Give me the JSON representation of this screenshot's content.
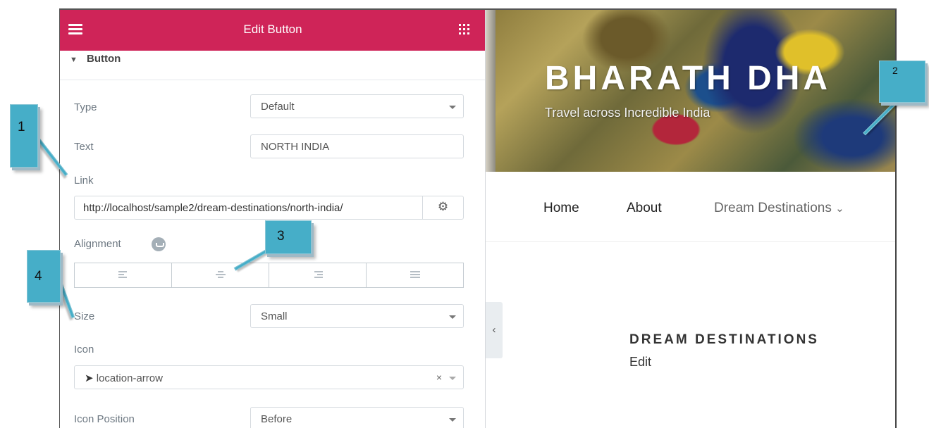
{
  "panel": {
    "title": "Edit Button",
    "section_title": "Button",
    "controls": {
      "type": {
        "label": "Type",
        "value": "Default"
      },
      "text": {
        "label": "Text",
        "value": "NORTH INDIA"
      },
      "link": {
        "label": "Link",
        "value": "http://localhost/sample2/dream-destinations/north-india/"
      },
      "alignment": {
        "label": "Alignment",
        "options": [
          "left",
          "center",
          "right",
          "justify"
        ]
      },
      "size": {
        "label": "Size",
        "value": "Small"
      },
      "icon": {
        "label": "Icon",
        "value": "location-arrow",
        "clear_glyph": "×"
      },
      "icon_position": {
        "label": "Icon Position",
        "value": "Before"
      }
    }
  },
  "preview": {
    "site_title": "BHARATH DHA",
    "tagline": "Travel across Incredible India",
    "nav": {
      "items": [
        "Home",
        "About",
        "Dream Destinations"
      ],
      "dropdown_glyph": "⌄"
    },
    "collapse_glyph": "‹",
    "widget": {
      "title": "DREAM DESTINATIONS",
      "link": "Edit"
    }
  },
  "callouts": [
    "1",
    "2",
    "3",
    "4"
  ],
  "colors": {
    "header": "#cf2458",
    "callout": "#46aec8",
    "panel_text": "#6d7882"
  }
}
